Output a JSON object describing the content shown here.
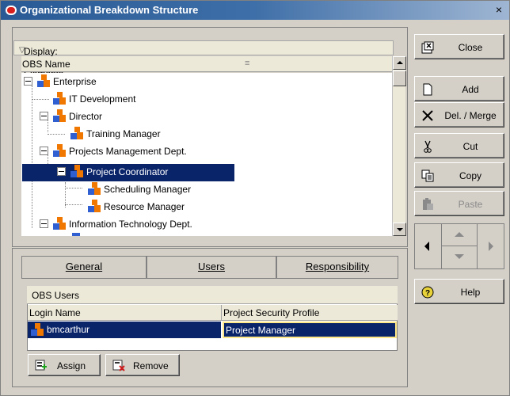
{
  "window": {
    "title": "Organizational Breakdown Structure",
    "close_glyph": "×"
  },
  "display_filter": "Display: All OBS Elements",
  "tree": {
    "column_header": "OBS Name",
    "nodes": [
      {
        "label": "Enterprise"
      },
      {
        "label": "IT Development"
      },
      {
        "label": "Director"
      },
      {
        "label": "Training Manager"
      },
      {
        "label": "Projects Management Dept."
      },
      {
        "label": "Project Coordinator"
      },
      {
        "label": "Scheduling Manager"
      },
      {
        "label": "Resource Manager"
      },
      {
        "label": "Information Technology Dept."
      }
    ],
    "selected": "Project Coordinator"
  },
  "tabs": [
    {
      "label": "General"
    },
    {
      "label": "Users"
    },
    {
      "label": "Responsibility"
    }
  ],
  "active_tab": "Users",
  "obs_users": {
    "title": "OBS Users",
    "columns": [
      "Login Name",
      "Project Security Profile"
    ],
    "rows": [
      {
        "login": "bmcarthur",
        "profile": "Project Manager"
      }
    ]
  },
  "buttons": {
    "assign": "Assign",
    "remove": "Remove",
    "close": "Close",
    "add": "Add",
    "delete_merge": "Del. / Merge",
    "cut": "Cut",
    "copy": "Copy",
    "paste": "Paste",
    "help": "Help"
  },
  "colors": {
    "title_bar": "#2a5a95",
    "selection": "#0a246a",
    "panel": "#d4d0c8",
    "obs_icon_orange": "#f07800",
    "obs_icon_blue": "#2f5fd0"
  }
}
